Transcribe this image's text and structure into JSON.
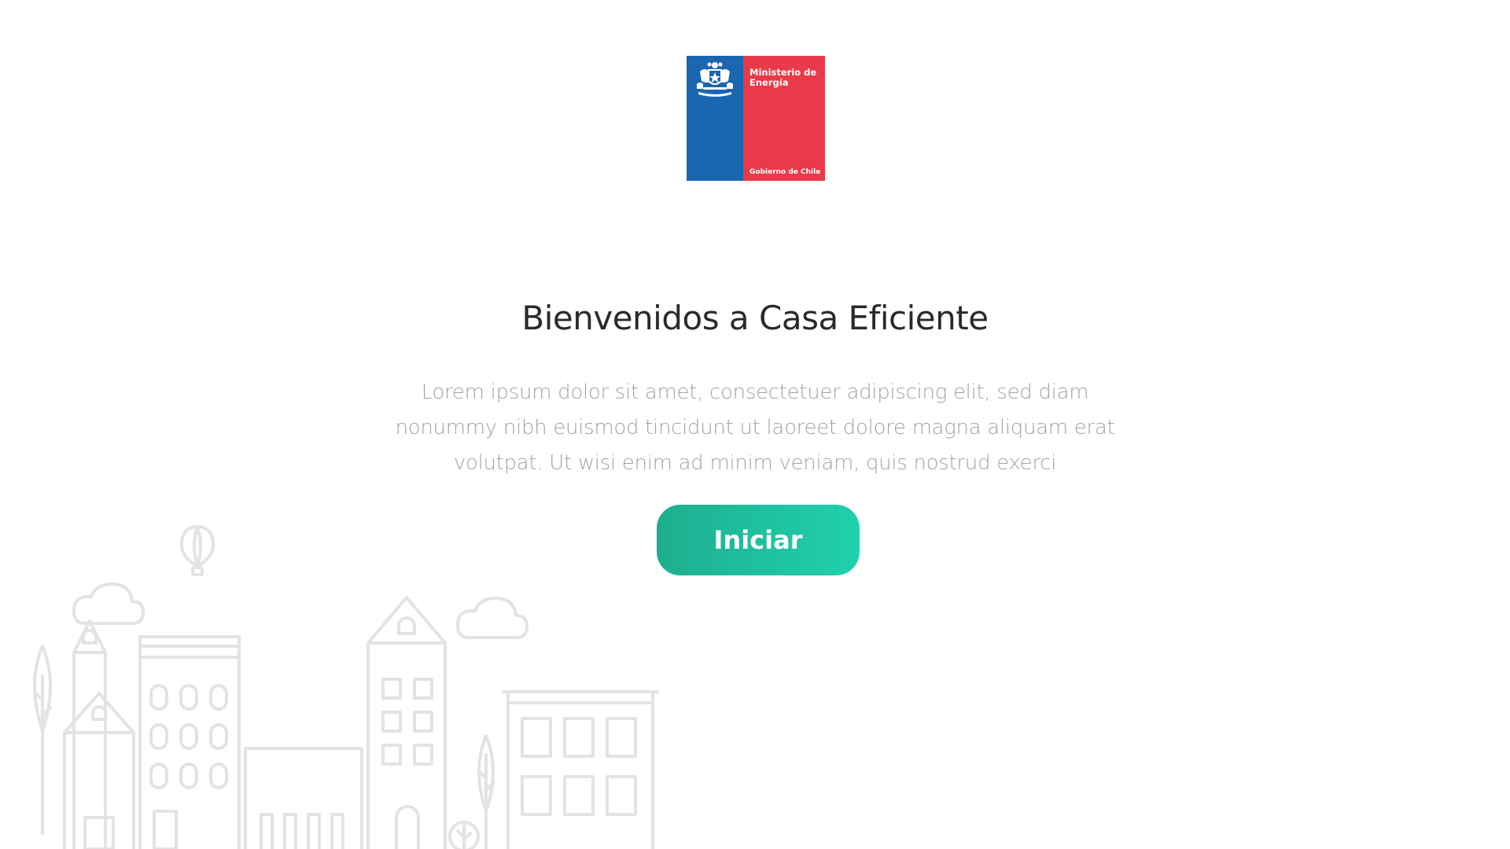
{
  "logo": {
    "ministry": "Ministerio de Energía",
    "government": "Gobierno de Chile",
    "colors": {
      "blue": "#1a66b0",
      "red": "#e83a48"
    }
  },
  "hero": {
    "title": "Bienvenidos a Casa Eficiente",
    "description": "Lorem ipsum dolor sit amet, consectetuer adipiscing elit, sed diam nonummy nibh euismod tincidunt ut laoreet dolore magna aliquam erat volutpat. Ut wisi enim ad minim veniam, quis nostrud exerci",
    "button_label": "Iniciar",
    "button_color": "#20c4a2"
  },
  "background": {
    "illustration": "city-outline-illustration",
    "line_color": "#e3e3e3"
  }
}
